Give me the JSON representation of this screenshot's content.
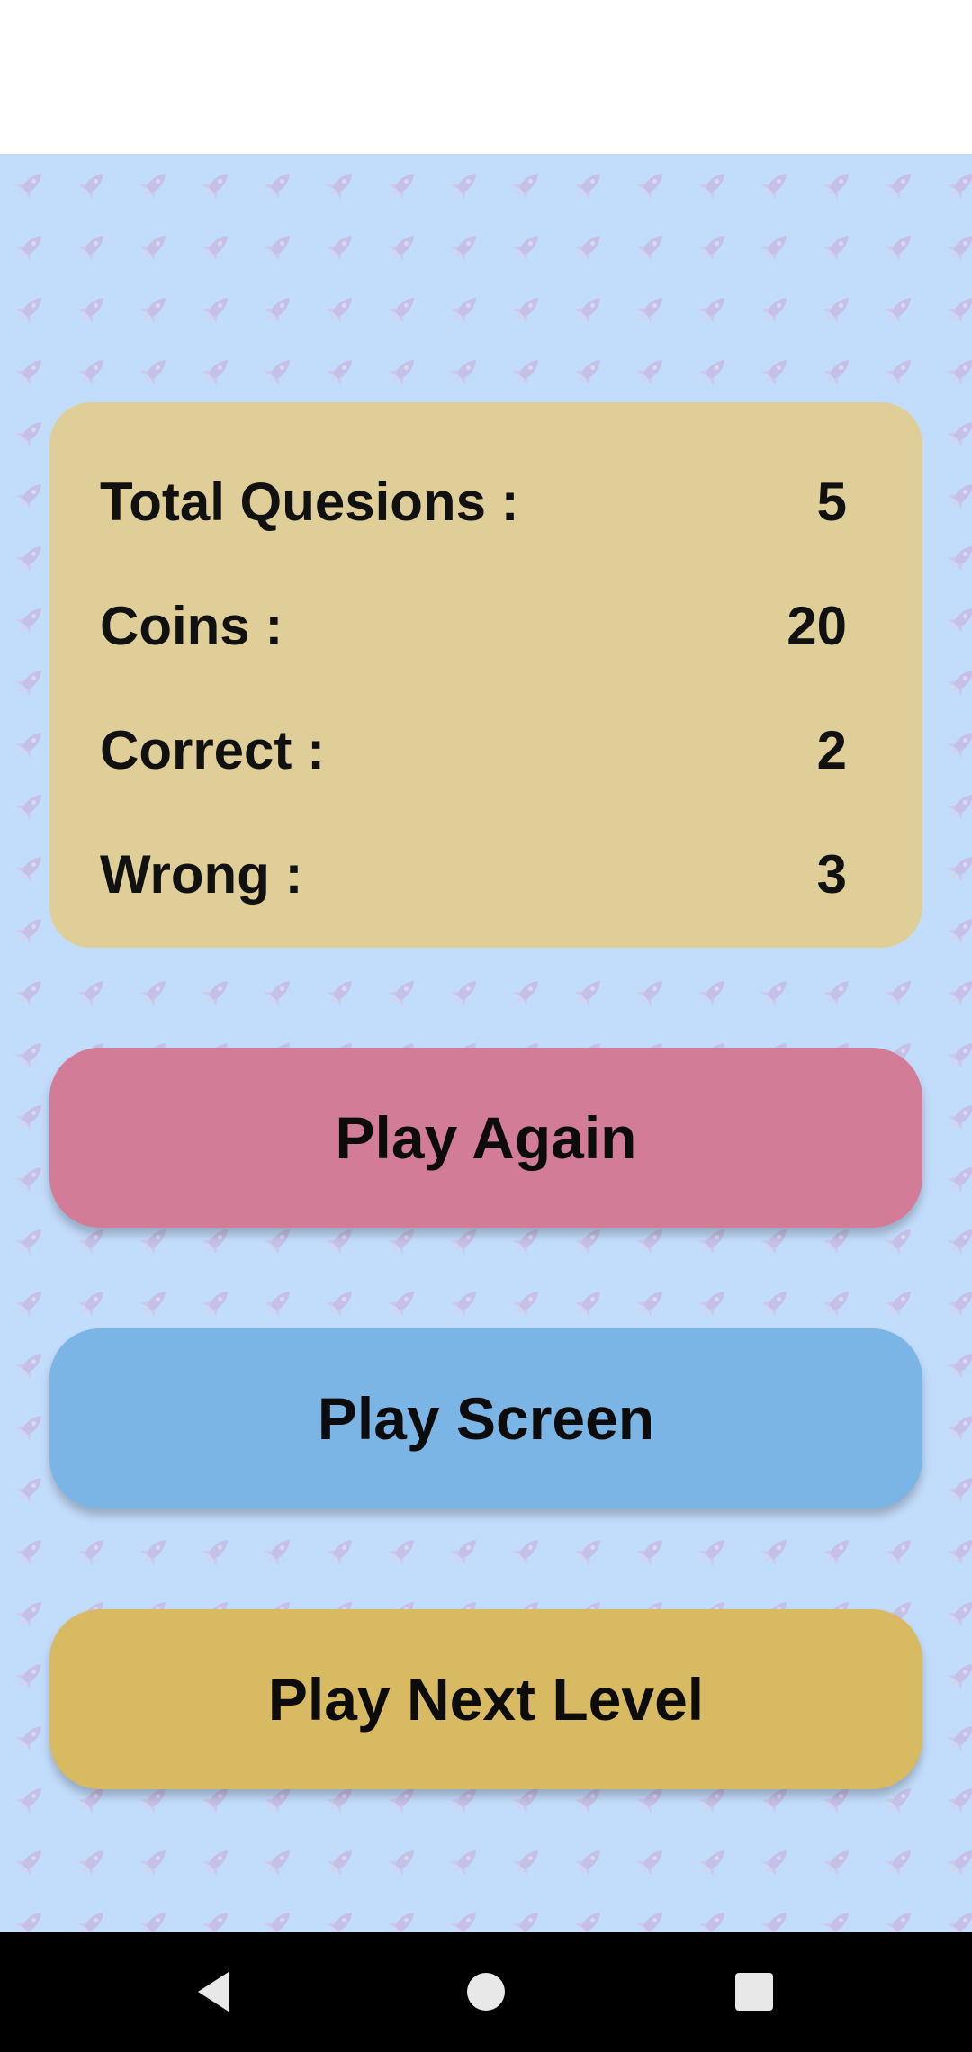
{
  "stats": {
    "rows": [
      {
        "label": "Total Quesions :",
        "value": "5"
      },
      {
        "label": "Coins :",
        "value": "20"
      },
      {
        "label": "Correct :",
        "value": "2"
      },
      {
        "label": "Wrong :",
        "value": "3"
      }
    ]
  },
  "buttons": {
    "play_again": "Play Again",
    "play_screen": "Play Screen",
    "play_next_level": "Play Next Level"
  },
  "navigation": {
    "back_icon": "back-triangle-icon",
    "home_icon": "home-circle-icon",
    "recents_icon": "recents-square-icon"
  },
  "colors": {
    "background": "#c2dcfb",
    "card": "#dfce98",
    "play_again": "#d27c98",
    "play_screen": "#7bb5e5",
    "play_next_level": "#d8ba62",
    "rocket": "#c7a5d4"
  }
}
